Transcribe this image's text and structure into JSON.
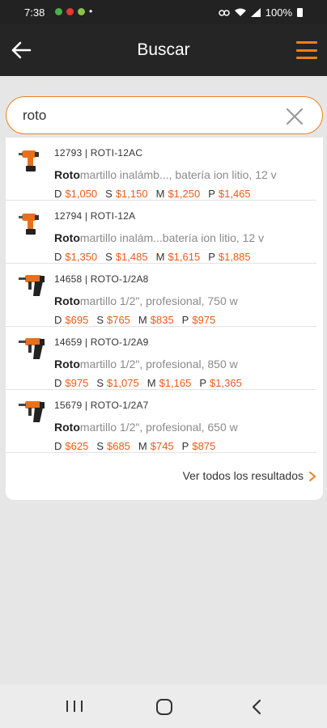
{
  "status_bar": {
    "time": "7:38",
    "battery": "100%",
    "dot": "•"
  },
  "header": {
    "title": "Buscar"
  },
  "search": {
    "value": "roto",
    "placeholder": ""
  },
  "results": [
    {
      "code": "12793 | ROTI-12AC",
      "desc_bold": "Roto",
      "desc_rest": "martillo inalámb..., batería ion litio, 12 v",
      "icon": "cordless-drill-icon",
      "prices": [
        {
          "level": "D",
          "value": "$1,050"
        },
        {
          "level": "S",
          "value": "$1,150"
        },
        {
          "level": "M",
          "value": "$1,250"
        },
        {
          "level": "P",
          "value": "$1,465"
        }
      ]
    },
    {
      "code": "12794 | ROTI-12A",
      "desc_bold": "Roto",
      "desc_rest": "martillo inalám...batería ion litio, 12 v",
      "icon": "cordless-drill-icon",
      "prices": [
        {
          "level": "D",
          "value": "$1,350"
        },
        {
          "level": "S",
          "value": "$1,485"
        },
        {
          "level": "M",
          "value": "$1,615"
        },
        {
          "level": "P",
          "value": "$1,885"
        }
      ]
    },
    {
      "code": "14658 | ROTO-1/2A8",
      "desc_bold": "Roto",
      "desc_rest": "martillo 1/2\", profesional, 750 w",
      "icon": "hammer-drill-icon",
      "prices": [
        {
          "level": "D",
          "value": "$695"
        },
        {
          "level": "S",
          "value": "$765"
        },
        {
          "level": "M",
          "value": "$835"
        },
        {
          "level": "P",
          "value": "$975"
        }
      ]
    },
    {
      "code": "14659 | ROTO-1/2A9",
      "desc_bold": "Roto",
      "desc_rest": "martillo 1/2\", profesional, 850 w",
      "icon": "hammer-drill-icon",
      "prices": [
        {
          "level": "D",
          "value": "$975"
        },
        {
          "level": "S",
          "value": "$1,075"
        },
        {
          "level": "M",
          "value": "$1,165"
        },
        {
          "level": "P",
          "value": "$1,365"
        }
      ]
    },
    {
      "code": "15679 | ROTO-1/2A7",
      "desc_bold": "Roto",
      "desc_rest": "martillo 1/2\", profesional, 650 w",
      "icon": "hammer-drill-icon",
      "prices": [
        {
          "level": "D",
          "value": "$625"
        },
        {
          "level": "S",
          "value": "$685"
        },
        {
          "level": "M",
          "value": "$745"
        },
        {
          "level": "P",
          "value": "$875"
        }
      ]
    }
  ],
  "see_all": {
    "label": "Ver todos los resultados"
  },
  "colors": {
    "accent": "#ef7f1a",
    "price": "#ef5a1a",
    "app_bar": "#252525"
  }
}
